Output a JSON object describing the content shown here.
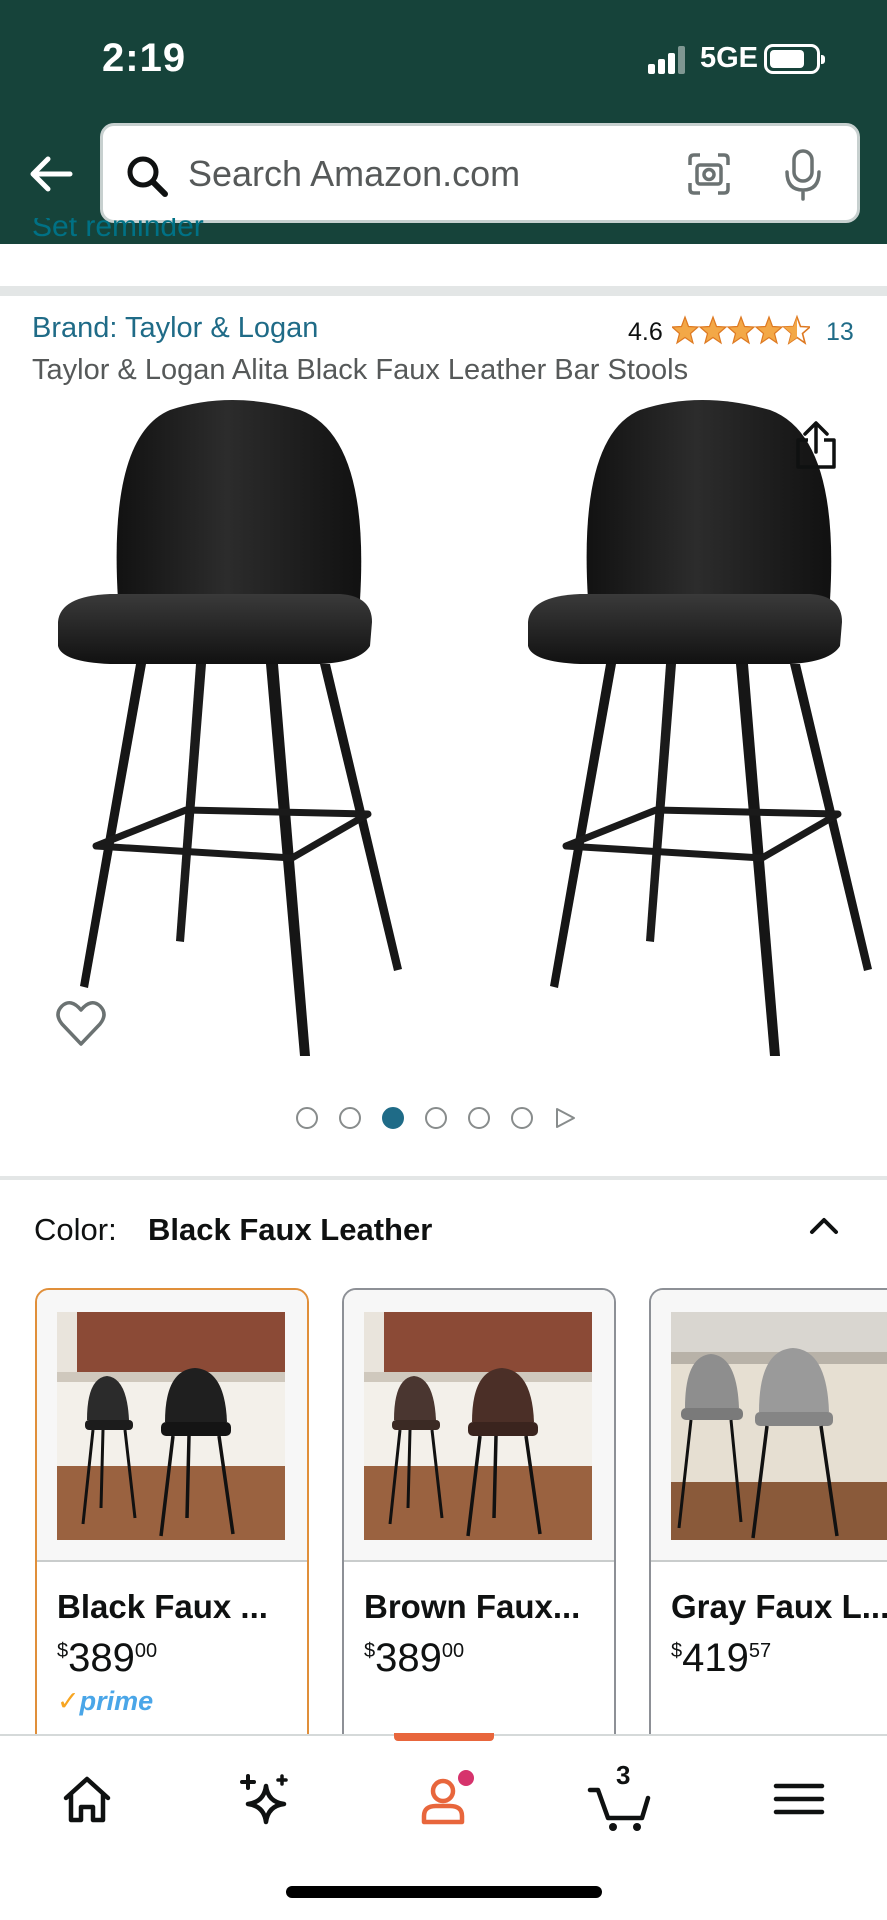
{
  "status_bar": {
    "time": "2:19",
    "network": "5GE"
  },
  "search": {
    "placeholder": "Search Amazon.com"
  },
  "reminder_peek": "Set reminder",
  "product": {
    "brand": "Brand: Taylor & Logan",
    "rating": "4.6",
    "rating_stars": 4.5,
    "rating_count": "13",
    "title": "Taylor & Logan Alita Black Faux Leather Bar Stools",
    "image_count": 6,
    "active_image_index": 2
  },
  "color": {
    "label": "Color:",
    "selected": "Black Faux Leather",
    "options": [
      {
        "name": "Black Faux ...",
        "price_symbol": "$",
        "price_whole": "389",
        "price_cents": "00",
        "prime": "prime",
        "selected": true
      },
      {
        "name": "Brown Faux...",
        "price_symbol": "$",
        "price_whole": "389",
        "price_cents": "00",
        "selected": false
      },
      {
        "name": "Gray Faux L...",
        "price_symbol": "$",
        "price_whole": "419",
        "price_cents": "57",
        "selected": false
      }
    ]
  },
  "nav": {
    "items": [
      "home-icon",
      "sparkle-icon",
      "account-icon",
      "cart-icon",
      "menu-icon"
    ],
    "cart_count": "3",
    "active": "account"
  },
  "colors": {
    "header_bg": "#16433a",
    "link": "#1f6b87",
    "star": "#f3a847",
    "selected_border": "#e08f3a",
    "nav_active": "#e8663c"
  }
}
